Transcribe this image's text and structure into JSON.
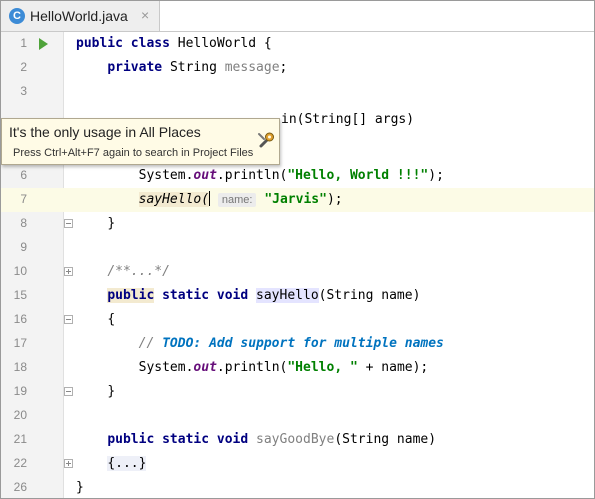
{
  "tab": {
    "file_icon_letter": "C",
    "file_name": "HelloWorld.java",
    "close_glyph": "×"
  },
  "tooltip": {
    "line1": "It's the only usage in All Places",
    "line2": "Press Ctrl+Alt+F7 again to search in Project Files",
    "icon": "settings-wrench-icon"
  },
  "gutter": {
    "line_numbers": [
      "1",
      "2",
      "3",
      "",
      "6",
      "7",
      "8",
      "9",
      "10",
      "15",
      "16",
      "17",
      "18",
      "19",
      "20",
      "21",
      "22",
      "26"
    ]
  },
  "code": {
    "l1": {
      "kw": "public class ",
      "rest": "HelloWorld {"
    },
    "l2": {
      "kw": "private ",
      "type": "String ",
      "field": "message",
      "end": ";"
    },
    "l3": {
      "visible": "in(String[] args)"
    },
    "l6": {
      "pre": "System.",
      "field": "out",
      "call": ".println(",
      "str": "\"Hello, World !!!\"",
      "end": ");"
    },
    "l7": {
      "call": "sayHello(",
      "hint": "name:",
      "str": "\"Jarvis\"",
      "end": ");"
    },
    "l8": {
      "text": "}"
    },
    "l10": {
      "text": "/**...*/"
    },
    "l15": {
      "kw1": "public",
      "kw2": " static void ",
      "name": "sayHello",
      "rest": "(String name)"
    },
    "l16": {
      "text": "{"
    },
    "l17": {
      "comment": "// ",
      "todo": "TODO: Add support for multiple names"
    },
    "l18": {
      "pre": "System.",
      "field": "out",
      "call": ".println(",
      "str": "\"Hello, \"",
      "rest": " + name);"
    },
    "l19": {
      "text": "}"
    },
    "l21": {
      "kw": "public static void ",
      "name": "sayGoodBye",
      "rest": "(String name)"
    },
    "l22": {
      "text": "{...}"
    },
    "l26": {
      "text": "}"
    }
  },
  "colors": {
    "keyword": "#000080",
    "string": "#008000",
    "field": "#660e7a",
    "run_icon": "#4fa33a",
    "tooltip_bg": "#fffbe6"
  }
}
